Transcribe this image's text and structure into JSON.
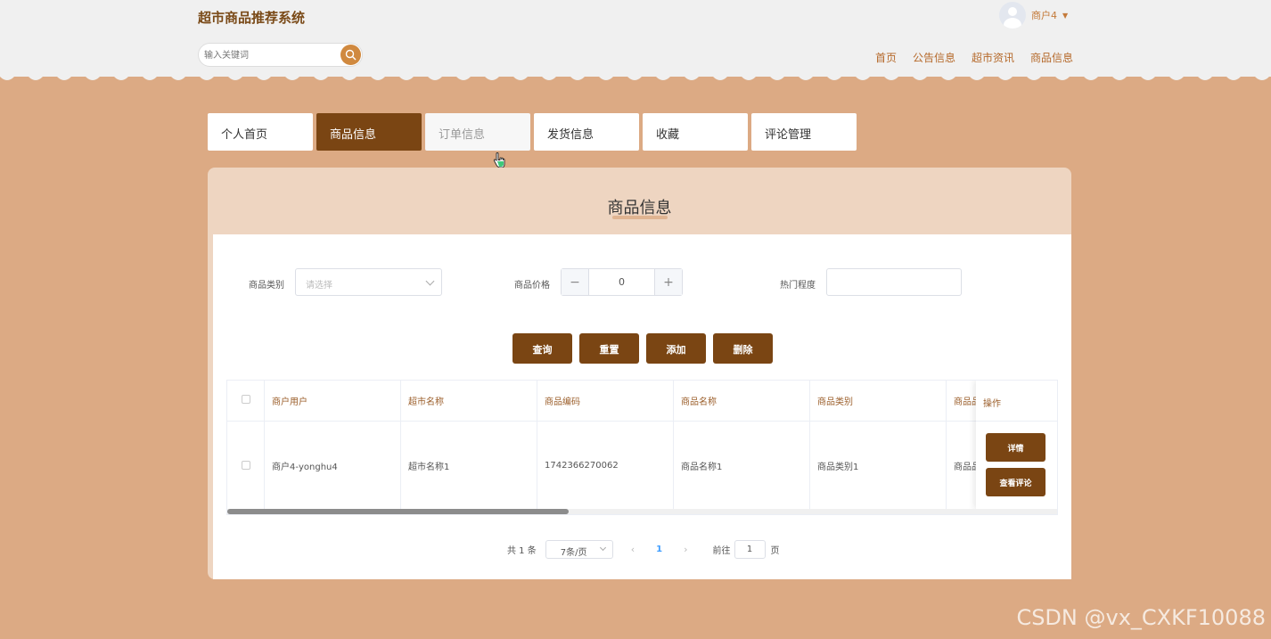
{
  "header": {
    "site_title": "超市商品推荐系统",
    "search_placeholder": "输入关键词",
    "user_name": "商户4",
    "nav": [
      "首页",
      "公告信息",
      "超市资讯",
      "商品信息"
    ]
  },
  "tabs": [
    {
      "label": "个人首页",
      "state": "normal"
    },
    {
      "label": "商品信息",
      "state": "active"
    },
    {
      "label": "订单信息",
      "state": "hover"
    },
    {
      "label": "发货信息",
      "state": "normal"
    },
    {
      "label": "收藏",
      "state": "normal"
    },
    {
      "label": "评论管理",
      "state": "normal"
    }
  ],
  "panel": {
    "title": "商品信息",
    "filters": {
      "category_label": "商品类别",
      "category_placeholder": "请选择",
      "price_label": "商品价格",
      "price_value": "0",
      "popularity_label": "热门程度",
      "popularity_value": ""
    },
    "actions": [
      "查询",
      "重置",
      "添加",
      "删除"
    ],
    "table": {
      "headers": [
        "商户用户",
        "超市名称",
        "商品编码",
        "商品名称",
        "商品类别",
        "商品品"
      ],
      "op_header": "操作",
      "rows": [
        [
          "商户4-yonghu4",
          "超市名称1",
          "1742366270062",
          "商品名称1",
          "商品类别1",
          "商品品"
        ]
      ],
      "row_actions": [
        "详情",
        "查看评论"
      ]
    },
    "pagination": {
      "total": "共 1 条",
      "page_size": "7条/页",
      "prev": "‹",
      "current": "1",
      "next": "›",
      "goto_label": "前往",
      "goto_value": "1",
      "page_suffix": "页"
    }
  },
  "watermark": "CSDN @vx_CXKF10088",
  "colors": {
    "background": "#dcaa84",
    "accent": "#7a4513",
    "panel": "#eed5c1",
    "nav_text": "#b5692a"
  }
}
